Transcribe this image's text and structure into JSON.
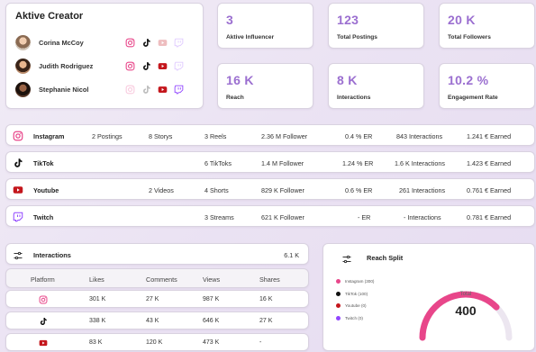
{
  "creators": {
    "title": "Aktive Creator",
    "list": [
      {
        "name": "Corina McCoy",
        "platforms": {
          "instagram": true,
          "tiktok": true,
          "youtube": false,
          "twitch": false
        }
      },
      {
        "name": "Judith Rodriguez",
        "platforms": {
          "instagram": true,
          "tiktok": true,
          "youtube": true,
          "twitch": false
        }
      },
      {
        "name": "Stephanie Nicol",
        "platforms": {
          "instagram": false,
          "tiktok": false,
          "youtube": true,
          "twitch": true
        }
      }
    ]
  },
  "stats": [
    {
      "value": "3",
      "label": "Aktive Influencer"
    },
    {
      "value": "123",
      "label": "Total Postings"
    },
    {
      "value": "20 K",
      "label": "Total Followers"
    },
    {
      "value": "16 K",
      "label": "Reach"
    },
    {
      "value": "8 K",
      "label": "Interactions"
    },
    {
      "value": "10.2 %",
      "label": "Engagement Rate"
    }
  ],
  "platforms": [
    {
      "name": "Instagram",
      "postings": "2 Postings",
      "stories": "8 Storys",
      "content": "3 Reels",
      "followers": "2.36 M Follower",
      "er": "0.4 % ER",
      "interactions": "843 Interactions",
      "earned": "1.241 € Earned"
    },
    {
      "name": "TikTok",
      "postings": "",
      "stories": "",
      "content": "6 TikToks",
      "followers": "1.4 M Follower",
      "er": "1.24 % ER",
      "interactions": "1.6 K Interactions",
      "earned": "1.423 € Earned"
    },
    {
      "name": "Youtube",
      "postings": "2 Videos",
      "stories": "",
      "content": "4 Shorts",
      "followers": "829 K Follower",
      "er": "0.6 % ER",
      "interactions": "261 Interactions",
      "earned": "0.761 € Earned"
    },
    {
      "name": "Twitch",
      "postings": "",
      "stories": "",
      "content": "3 Streams",
      "followers": "621 K Follower",
      "er": "- ER",
      "interactions": "- Interactions",
      "earned": "0.781 € Earned"
    }
  ],
  "interactions": {
    "title": "Interactions",
    "total": "6.1 K",
    "columns": [
      "Platform",
      "Likes",
      "Comments",
      "Views",
      "Shares"
    ],
    "rows": [
      {
        "platform": "instagram",
        "likes": "301 K",
        "comments": "27 K",
        "views": "987 K",
        "shares": "16 K"
      },
      {
        "platform": "tiktok",
        "likes": "338 K",
        "comments": "43 K",
        "views": "646 K",
        "shares": "27 K"
      },
      {
        "platform": "youtube",
        "likes": "83 K",
        "comments": "120 K",
        "views": "473 K",
        "shares": "-"
      }
    ]
  },
  "reach_split": {
    "title": "Reach Split",
    "legend": [
      {
        "label": "Instagram (300)",
        "color": "#e8468a"
      },
      {
        "label": "TikTok (100)",
        "color": "#111111"
      },
      {
        "label": "Youtube (0)",
        "color": "#c4161c"
      },
      {
        "label": "Twitch (0)",
        "color": "#9146ff"
      }
    ],
    "center_label": "Total",
    "total": "400",
    "instagram_fraction": 0.75
  },
  "colors": {
    "accent": "#9b6fd0",
    "instagram": "#e8468a",
    "tiktok": "#111111",
    "youtube": "#c4161c",
    "twitch": "#9146ff"
  }
}
